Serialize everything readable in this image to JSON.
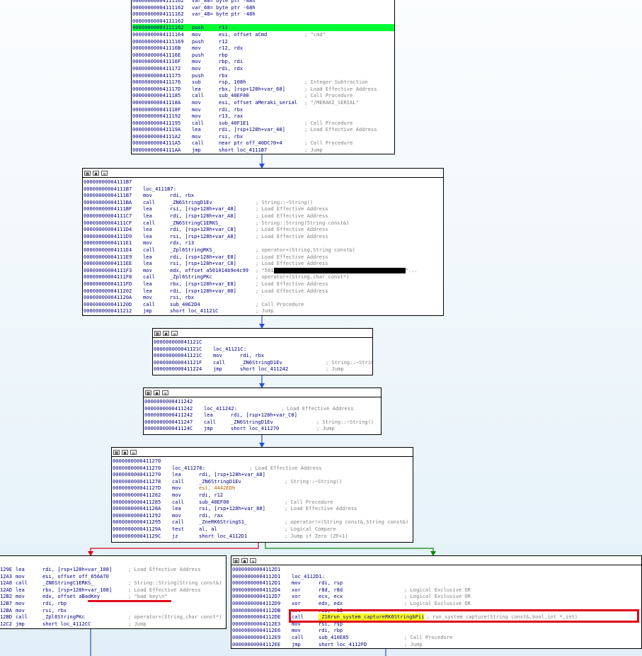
{
  "header_icons": [
    "graph-icon",
    "edit-icon",
    "list-icon"
  ],
  "header_glyphs": [
    "▦",
    "◆",
    "≡"
  ],
  "colors": {
    "edge_blue": "#2a4fd8",
    "edge_red": "#e0001b",
    "edge_green": "#0b8a0b",
    "highlight_green": "#00ff33",
    "annotation_red": "#e0001b"
  },
  "blocks": [
    {
      "id": "b1",
      "lines": [
        {
          "addr": "00000000004111162",
          "text": "var_88= byte ptr -88h"
        },
        {
          "addr": "00000000004111162",
          "text": "var_68= byte ptr -68h"
        },
        {
          "addr": "00000000004111162",
          "text": "var_48= byte ptr -48h"
        },
        {
          "addr": "00000000004111162",
          "text": ""
        },
        {
          "addr": "00000000004111162",
          "mn": "push",
          "op": "r13"
        },
        {
          "addr": "00000000004111164",
          "mn": "mov",
          "op": "esi, offset aCmd",
          "cm": "; \"cmd\""
        },
        {
          "addr": "00000000004111169",
          "mn": "push",
          "op": "r12"
        },
        {
          "addr": "000000000041116B",
          "mn": "mov",
          "op": "r12, rdx"
        },
        {
          "addr": "000000000041116E",
          "mn": "push",
          "op": "rbp"
        },
        {
          "addr": "000000000041116F",
          "mn": "mov",
          "op": "rbp, rdi"
        },
        {
          "addr": "0000000000411172",
          "mn": "mov",
          "op": "rdi, rdx"
        },
        {
          "addr": "0000000000411175",
          "mn": "push",
          "op": "rbx"
        },
        {
          "addr": "0000000000411176",
          "mn": "sub",
          "op": "rsp, 108h",
          "cm": "; Integer Subtraction"
        },
        {
          "addr": "000000000041117D",
          "mn": "lea",
          "op": "rbx, [rsp+128h+var_68]",
          "cm": "; Load Effective Address"
        },
        {
          "addr": "0000000000411185",
          "mn": "call",
          "op": "sub_40EF00",
          "cm": "; Call Procedure"
        },
        {
          "addr": "000000000041118A",
          "mn": "mov",
          "op": "esi, offset aMeraki_serial",
          "cm": "; \"/MERAKI_SERIAL\""
        },
        {
          "addr": "000000000041118F",
          "mn": "mov",
          "op": "rdi, rbx"
        },
        {
          "addr": "0000000000411192",
          "mn": "mov",
          "op": "r13, rax"
        },
        {
          "addr": "0000000000411195",
          "mn": "call",
          "op": "sub_40F1E1",
          "cm": "; Call Procedure"
        },
        {
          "addr": "000000000041119A",
          "mn": "lea",
          "op": "rdi, [rsp+128h+var_48]",
          "cm": "; Load Effective Address"
        },
        {
          "addr": "00000000004111A2",
          "mn": "mov",
          "op": "rsi, rbx"
        },
        {
          "addr": "00000000004111A5",
          "mn": "call",
          "op": "near ptr off_40DC70+4",
          "cm": "; Call Procedure"
        },
        {
          "addr": "00000000004111AA",
          "mn": "jmp",
          "op": "short loc_4111B7",
          "cm": "; Jump"
        }
      ]
    },
    {
      "id": "b2",
      "lines": [
        {
          "addr": "00000000004111B7",
          "text": ""
        },
        {
          "addr": "00000000004111B7",
          "text": "loc_4111B7:"
        },
        {
          "addr": "00000000004111B7",
          "mn": "mov",
          "op": "rdi, rbx"
        },
        {
          "addr": "00000000004111BA",
          "mn": "call",
          "op": "_ZN6StringD1Ev",
          "cm": "; String::~String()"
        },
        {
          "addr": "00000000004111BF",
          "mn": "lea",
          "op": "rsi, [rsp+128h+var_48]",
          "cm": "; Load Effective Address"
        },
        {
          "addr": "00000000004111C7",
          "mn": "lea",
          "op": "rdi, [rsp+128h+var_A8]",
          "cm": "; Load Effective Address"
        },
        {
          "addr": "00000000004111CF",
          "mn": "call",
          "op": "_ZN6StringC1ERKS_",
          "cm": "; String::String(String const&)"
        },
        {
          "addr": "00000000004111D4",
          "mn": "lea",
          "op": "rdi, [rsp+128h+var_C8]",
          "cm": "; Load Effective Address"
        },
        {
          "addr": "00000000004111D9",
          "mn": "lea",
          "op": "rsi, [rsp+128h+var_A8]",
          "cm": "; Load Effective Address"
        },
        {
          "addr": "00000000004111E1",
          "mn": "mov",
          "op": "rdx, r13"
        },
        {
          "addr": "00000000004111E4",
          "mn": "call",
          "op": "_Zpl6StringRKS_",
          "cm": "; operator+(String,String const&)"
        },
        {
          "addr": "00000000004111E9",
          "mn": "lea",
          "op": "rdi, [rsp+128h+var_E8]",
          "cm": "; Load Effective Address"
        },
        {
          "addr": "00000000004111EE",
          "mn": "lea",
          "op": "rsi, [rsp+128h+var_C8]",
          "cm": "; Load Effective Address"
        },
        {
          "addr": "00000000004111F3",
          "mn": "mov",
          "op": "edx, offset a501014b9e4c99",
          "cm": "; \"501",
          "redact": true,
          "tail": "\"..."
        },
        {
          "addr": "00000000004111F8",
          "mn": "call",
          "op": "_Zpl6StringPKc",
          "cm": "; operator+(String,char const*)"
        },
        {
          "addr": "00000000004111FD",
          "mn": "lea",
          "op": "rbx, [rsp+128h+var_E8]",
          "cm": "; Load Effective Address"
        },
        {
          "addr": "0000000000411202",
          "mn": "lea",
          "op": "rdi, [rsp+128h+var_88]",
          "cm": "; Load Effective Address"
        },
        {
          "addr": "000000000041120A",
          "mn": "mov",
          "op": "rsi, rbx"
        },
        {
          "addr": "000000000041120D",
          "mn": "call",
          "op": "sub_40E2D4",
          "cm": "; Call Procedure"
        },
        {
          "addr": "0000000000411212",
          "mn": "jmp",
          "op": "short loc_41121C",
          "cm": "; Jump"
        }
      ]
    },
    {
      "id": "b3",
      "lines": [
        {
          "addr": "000000000041121C",
          "text": ""
        },
        {
          "addr": "000000000041121C",
          "text": "loc_41121C:"
        },
        {
          "addr": "000000000041121C",
          "mn": "mov",
          "op": "rdi, rbx"
        },
        {
          "addr": "000000000041121F",
          "mn": "call",
          "op": "_ZN6StringD1Ev",
          "cm": "; String::~String()"
        },
        {
          "addr": "0000000000411224",
          "mn": "jmp",
          "op": "short loc_411242",
          "cm": "; Jump"
        }
      ]
    },
    {
      "id": "b4",
      "lines": [
        {
          "addr": "0000000000411242",
          "text": ""
        },
        {
          "addr": "0000000000411242",
          "text": "loc_411242:",
          "cm": "; Load Effective Address"
        },
        {
          "addr": "0000000000411242",
          "mn": "lea",
          "op": "rdi, [rsp+128h+var_C8]"
        },
        {
          "addr": "0000000000411247",
          "mn": "call",
          "op": "_ZN6StringD1Ev",
          "cm": "; String::~String()"
        },
        {
          "addr": "000000000041124C",
          "mn": "jmp",
          "op": "short loc_411270",
          "cm": "; Jump"
        }
      ]
    },
    {
      "id": "b5",
      "lines": [
        {
          "addr": "0000000000411270",
          "text": ""
        },
        {
          "addr": "0000000000411270",
          "text": "loc_411270:",
          "cm": "; Load Effective Address"
        },
        {
          "addr": "0000000000411270",
          "mn": "lea",
          "op": "rdi, [rsp+128h+var_A8]"
        },
        {
          "addr": "0000000000411278",
          "mn": "call",
          "op": "_ZN6StringD1Ev",
          "cm": "; String::~String()"
        },
        {
          "addr": "000000000041127D",
          "mn": "mov",
          "op": "esi, 4442EDh",
          "num": true
        },
        {
          "addr": "0000000000411282",
          "mn": "mov",
          "op": "rdi, r12"
        },
        {
          "addr": "0000000000411285",
          "mn": "call",
          "op": "sub_40EF00",
          "cm": "; Call Procedure"
        },
        {
          "addr": "000000000041128A",
          "mn": "lea",
          "op": "rsi, [rsp+128h+var_88]",
          "cm": "; Load Effective Address"
        },
        {
          "addr": "0000000000411292",
          "mn": "mov",
          "op": "rdi, rax"
        },
        {
          "addr": "0000000000411295",
          "mn": "call",
          "op": "_ZneRK6StringS1_",
          "cm": "; operator!=(String const&,String const&)"
        },
        {
          "addr": "000000000041129A",
          "mn": "test",
          "op": "al, al",
          "cm": "; Logical Compare"
        },
        {
          "addr": "000000000041129C",
          "mn": "jz",
          "op": "short loc_4112D1",
          "cm": "; Jump if Zero (ZF=1)"
        }
      ]
    },
    {
      "id": "b6",
      "lines": [
        {
          "addr": "129E",
          "mn": "lea",
          "op": "rdi, [rsp+128h+var_108]",
          "cm": "; Load Effective Address"
        },
        {
          "addr": "12A3",
          "mn": "mov",
          "op": "esi, offset off_656A70"
        },
        {
          "addr": "12A8",
          "mn": "call",
          "op": "_ZN6StringC1ERKS_",
          "cm": "; String::String(String const&)"
        },
        {
          "addr": "12AD",
          "mn": "lea",
          "op": "rbx, [rsp+128h+var_108]",
          "cm": "; Load Effective Address"
        },
        {
          "addr": "12B2",
          "mn": "mov",
          "op": "edx, offset aBadKey",
          "cm": "; \"bad key\\n\""
        },
        {
          "addr": "12B7",
          "mn": "mov",
          "op": "rdi, rbp"
        },
        {
          "addr": "12BA",
          "mn": "mov",
          "op": "rsi, rbx"
        },
        {
          "addr": "12BD",
          "mn": "call",
          "op": "_Zpl6StringPKc",
          "cm": "; operator+(String,char const*)"
        },
        {
          "addr": "12C2",
          "mn": "jmp",
          "op": "short loc_4112CC",
          "cm": "; Jump"
        }
      ]
    },
    {
      "id": "b7",
      "lines": [
        {
          "addr": "00000000004112D1",
          "text": ""
        },
        {
          "addr": "00000000004112D1",
          "text": "loc_4112D1:"
        },
        {
          "addr": "00000000004112D1",
          "mn": "mov",
          "op": "rdi, rsp"
        },
        {
          "addr": "00000000004112D4",
          "mn": "xor",
          "op": "r8d, r8d",
          "cm": "; Logical Exclusive OR"
        },
        {
          "addr": "00000000004112D7",
          "mn": "xor",
          "op": "ecx, ecx",
          "cm": "; Logical Exclusive OR"
        },
        {
          "addr": "00000000004112D9",
          "mn": "xor",
          "op": "edx, edx",
          "cm": "; Logical Exclusive OR"
        },
        {
          "addr": "00000000004112DB",
          "mn": "mov",
          "op": "rsi, r12"
        },
        {
          "addr": "00000000004112DE",
          "mn": "call",
          "op": "_Z18run_system_captureRK6StringbPii",
          "cm": "; run_system_capture(String const&,bool,int *,int)",
          "yellow": true
        },
        {
          "addr": "00000000004112E3",
          "mn": "mov",
          "op": "rsi, rsp"
        },
        {
          "addr": "00000000004112E6",
          "mn": "mov",
          "op": "rdi, rbp"
        },
        {
          "addr": "00000000004112E9",
          "mn": "call",
          "op": "sub_410E85",
          "cm": "; Call Procedure"
        },
        {
          "addr": "00000000004112EE",
          "mn": "jmp",
          "op": "short loc_4112FD",
          "cm": "; Jump"
        }
      ]
    }
  ]
}
